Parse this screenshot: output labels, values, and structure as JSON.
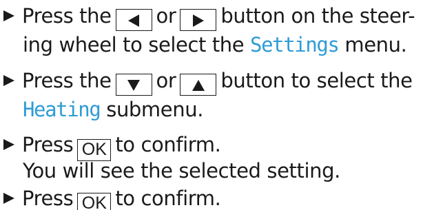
{
  "steps": [
    {
      "line1_pre": "Press the",
      "line1_or": "or",
      "line1_post": "button on the steer-",
      "line2_pre": "ing wheel to select the ",
      "line2_display": "Settings",
      "line2_post": " menu.",
      "keys": [
        "left-arrow",
        "right-arrow"
      ]
    },
    {
      "line1_pre": "Press the",
      "line1_or": "or",
      "line1_post": "button to select the",
      "line2_display": "Heating",
      "line2_post": " submenu.",
      "keys": [
        "down-arrow",
        "up-arrow"
      ]
    },
    {
      "line1_pre": "Press",
      "key_label": "OK",
      "line1_post": "to confirm.",
      "line2": "You will see the selected setting."
    },
    {
      "line1_pre": "Press",
      "key_label": "OK",
      "line1_post": "to confirm."
    }
  ],
  "colors": {
    "text": "#1a1a1a",
    "display_text": "#2e9cd6"
  },
  "icons": {
    "bullet": "triangle-bullet-icon"
  }
}
